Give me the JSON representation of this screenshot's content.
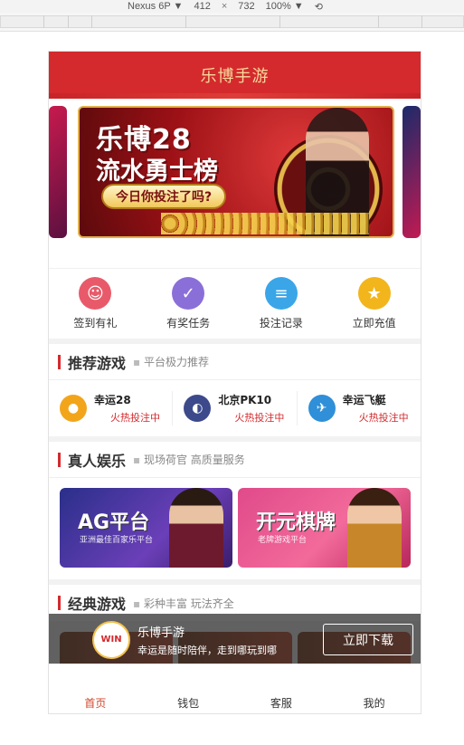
{
  "devtools": {
    "device": "Nexus 6P",
    "width": "412",
    "times": "×",
    "height": "732",
    "zoom": "100%",
    "rotate_icon": "rotate-icon"
  },
  "app": {
    "title": "乐博手游"
  },
  "banner": {
    "line1": "乐博28",
    "line2": "流水勇士榜",
    "pill": "今日你投注了吗?"
  },
  "quick_actions": [
    {
      "label": "签到有礼",
      "icon": "smile-icon",
      "color": "#e85a6a"
    },
    {
      "label": "有奖任务",
      "icon": "clipboard-check-icon",
      "color": "#8b6fd8"
    },
    {
      "label": "投注记录",
      "icon": "receipt-icon",
      "color": "#3aa6e8"
    },
    {
      "label": "立即充值",
      "icon": "star-coin-icon",
      "color": "#f2b51b"
    }
  ],
  "recommended": {
    "title": "推荐游戏",
    "subtitle": "平台极力推荐",
    "games": [
      {
        "name": "幸运28",
        "status": "火热投注中",
        "icon": "lucky28-icon"
      },
      {
        "name": "北京PK10",
        "status": "火热投注中",
        "icon": "pk10-icon"
      },
      {
        "name": "幸运飞艇",
        "status": "火热投注中",
        "icon": "airship-icon"
      }
    ]
  },
  "live": {
    "title": "真人娱乐",
    "subtitle": "现场荷官 高质量服务",
    "cards": [
      {
        "name": "AG平台",
        "tagline": "亚洲最佳百家乐平台"
      },
      {
        "name": "开元棋牌",
        "tagline": "老牌游戏平台"
      }
    ]
  },
  "classic": {
    "title": "经典游戏",
    "subtitle": "彩种丰富 玩法齐全"
  },
  "download_bar": {
    "logo_text": "WIN",
    "title": "乐博手游",
    "subtitle": "幸运是随时陪伴，走到哪玩到哪",
    "button": "立即下载"
  },
  "tabbar": [
    {
      "label": "首页",
      "active": true
    },
    {
      "label": "钱包",
      "active": false
    },
    {
      "label": "客服",
      "active": false
    },
    {
      "label": "我的",
      "active": false
    }
  ],
  "colors": {
    "brand_red": "#d42a2d",
    "header_text": "#f5d99b",
    "tab_active": "#d0472a"
  }
}
